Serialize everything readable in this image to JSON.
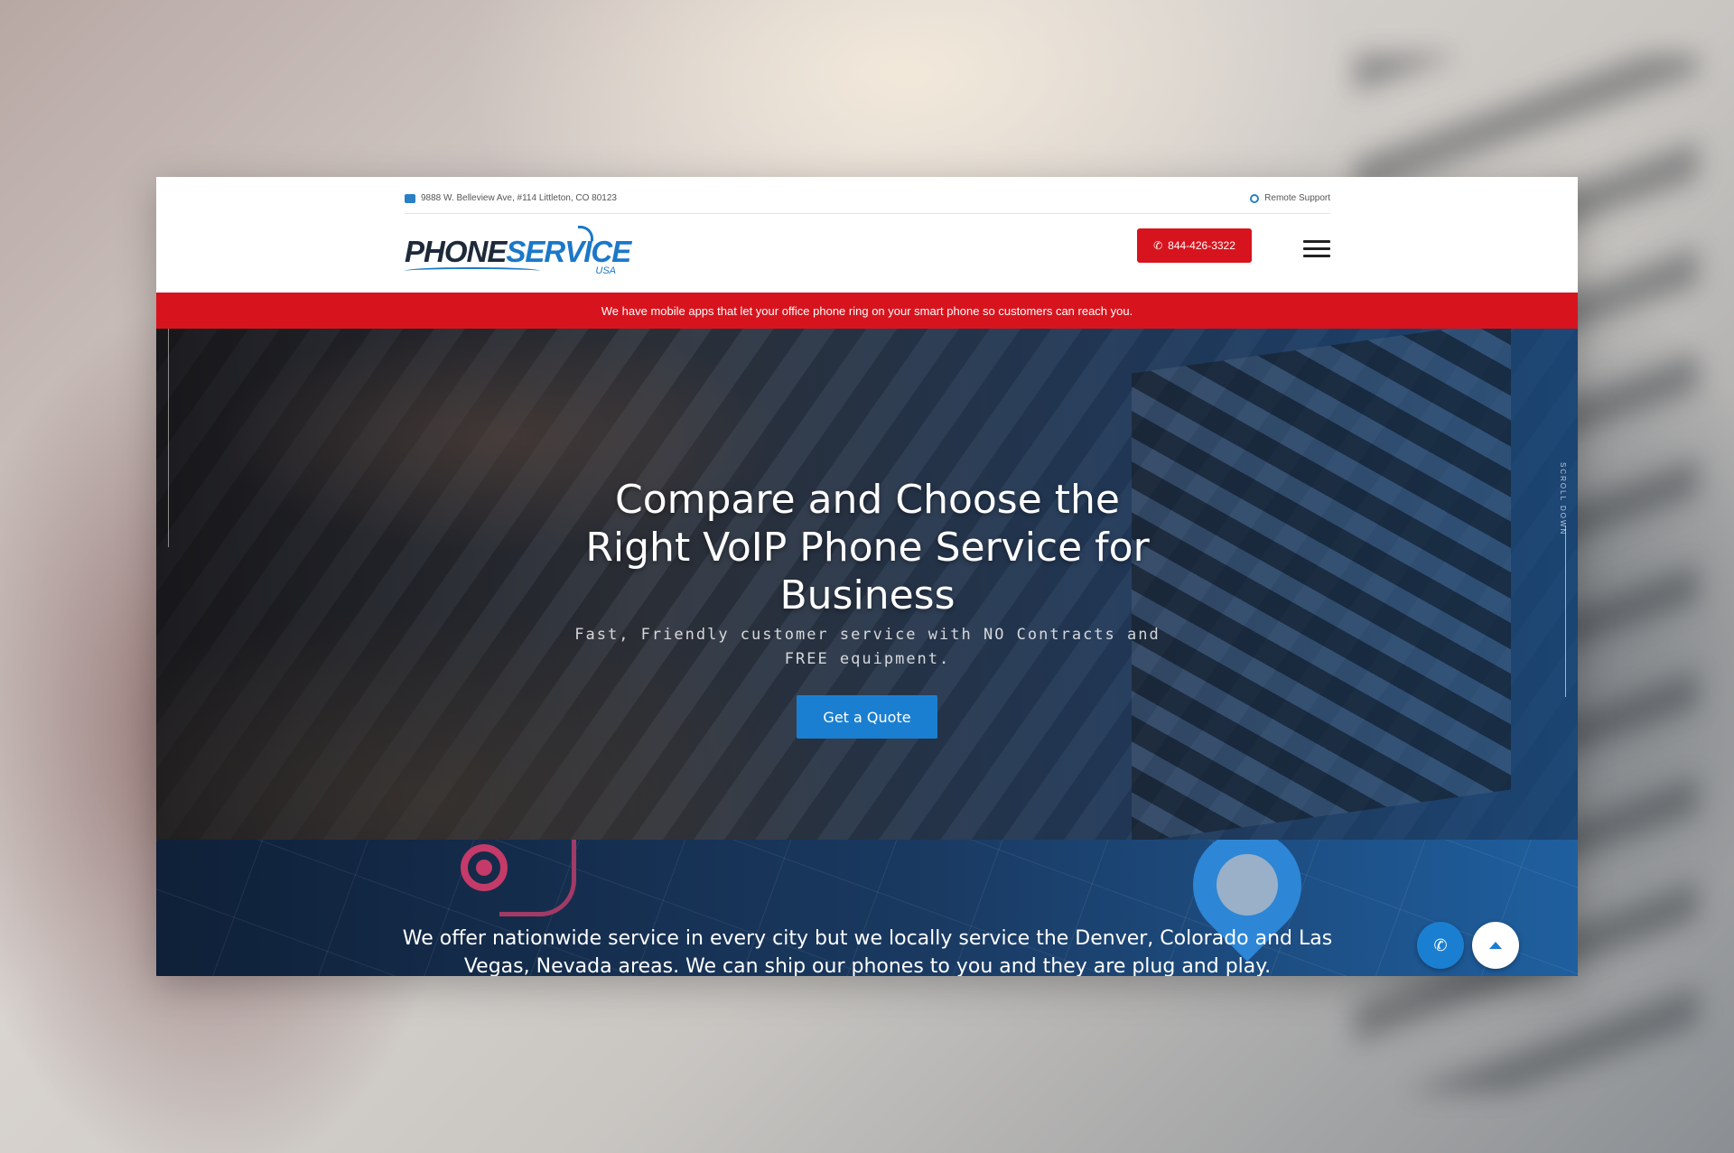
{
  "topbar": {
    "address": "9888 W. Belleview Ave, #114 Littleton, CO 80123",
    "support_label": "Remote Support"
  },
  "header": {
    "logo_word1": "PHONE",
    "logo_word2": "SERVICE",
    "logo_suffix": "USA",
    "phone_button": "844-426-3322"
  },
  "promo": {
    "text": "We have mobile apps that let your office phone ring on your smart phone so customers can reach you."
  },
  "hero": {
    "title": "Compare and Choose the Right VoIP Phone Service for Business",
    "subtitle": "Fast, Friendly customer service with NO Contracts and FREE equipment.",
    "cta": "Get a Quote",
    "scroll_label": "SCROLL DOWN"
  },
  "service": {
    "text": "We offer nationwide service in every city but we locally service the Denver, Colorado and Las Vegas, Nevada areas. We can ship our phones to you and they are plug and play."
  },
  "colors": {
    "brand_red": "#d7141d",
    "brand_blue": "#1b7fd1"
  },
  "icons": {
    "address": "map-icon",
    "support": "headset-icon",
    "call": "phone-icon",
    "menu": "hamburger-icon",
    "back_to_top": "arrow-up-icon"
  }
}
